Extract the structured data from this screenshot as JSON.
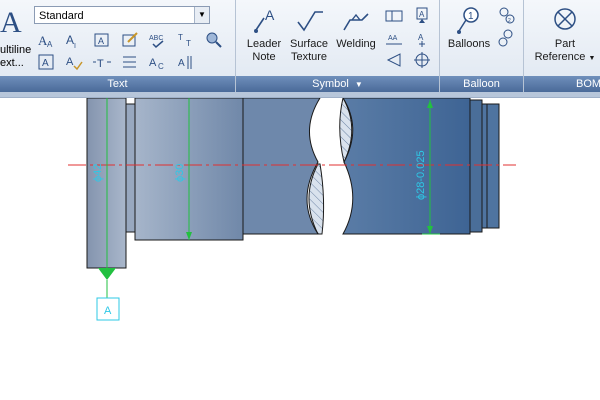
{
  "ribbon": {
    "text_panel": {
      "title": "Text",
      "big_button_glyph": "A",
      "multiline_label_1": "ultiline",
      "multiline_label_2": "ext...",
      "style_value": "Standard"
    },
    "symbol_panel": {
      "title": "Symbol",
      "leader_note_1": "Leader",
      "leader_note_2": "Note",
      "surface_texture_1": "Surface",
      "surface_texture_2": "Texture",
      "welding": "Welding"
    },
    "balloon_panel": {
      "title": "Balloon",
      "balloons": "Balloons"
    },
    "bom_panel": {
      "title": "BOM",
      "part_reference_1": "Part",
      "part_reference_2": "Reference"
    }
  },
  "drawing": {
    "dim_left": "ϕ42",
    "dim_mid": "ϕ30",
    "dim_right": "ϕ28-0.025",
    "datum_label": "A"
  }
}
